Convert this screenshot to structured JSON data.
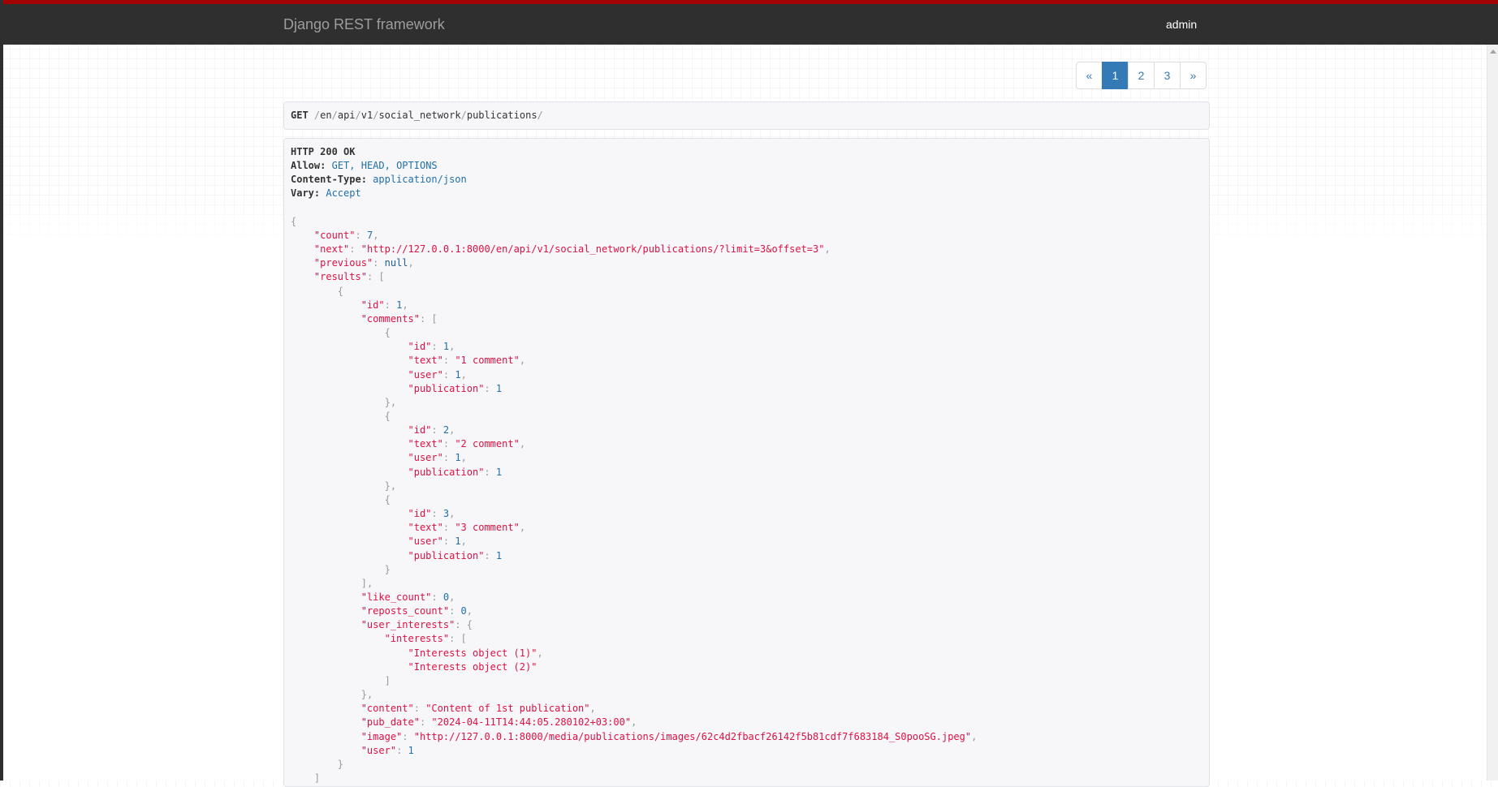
{
  "navbar": {
    "brand": "Django REST framework",
    "user": "admin",
    "accent_color": "#a30000",
    "background_color": "#2f2f2f"
  },
  "pagination": {
    "prev": "«",
    "pages": [
      "1",
      "2",
      "3"
    ],
    "active": "1",
    "next": "»"
  },
  "request": {
    "method": "GET",
    "path_segments": [
      "en",
      "api",
      "v1",
      "social_network",
      "publications"
    ]
  },
  "response": {
    "status": "HTTP 200 OK",
    "headers": [
      {
        "name": "Allow:",
        "value": "GET, HEAD, OPTIONS"
      },
      {
        "name": "Content-Type:",
        "value": "application/json"
      },
      {
        "name": "Vary:",
        "value": "Accept"
      }
    ],
    "body": {
      "count": 7,
      "next": "http://127.0.0.1:8000/en/api/v1/social_network/publications/?limit=3&offset=3",
      "previous": null,
      "results": [
        {
          "id": 1,
          "comments": [
            {
              "id": 1,
              "text": "1 comment",
              "user": 1,
              "publication": 1
            },
            {
              "id": 2,
              "text": "2 comment",
              "user": 1,
              "publication": 1
            },
            {
              "id": 3,
              "text": "3 comment",
              "user": 1,
              "publication": 1
            }
          ],
          "like_count": 0,
          "reposts_count": 0,
          "user_interests": {
            "interests": [
              "Interests object (1)",
              "Interests object (2)"
            ]
          },
          "content": "Content of 1st publication",
          "pub_date": "2024-04-11T14:44:05.280102+03:00",
          "image": "http://127.0.0.1:8000/media/publications/images/62c4d2fbacf26142f5b81cdf7f683184_S0pooSG.jpeg",
          "user": 1
        }
      ]
    }
  }
}
